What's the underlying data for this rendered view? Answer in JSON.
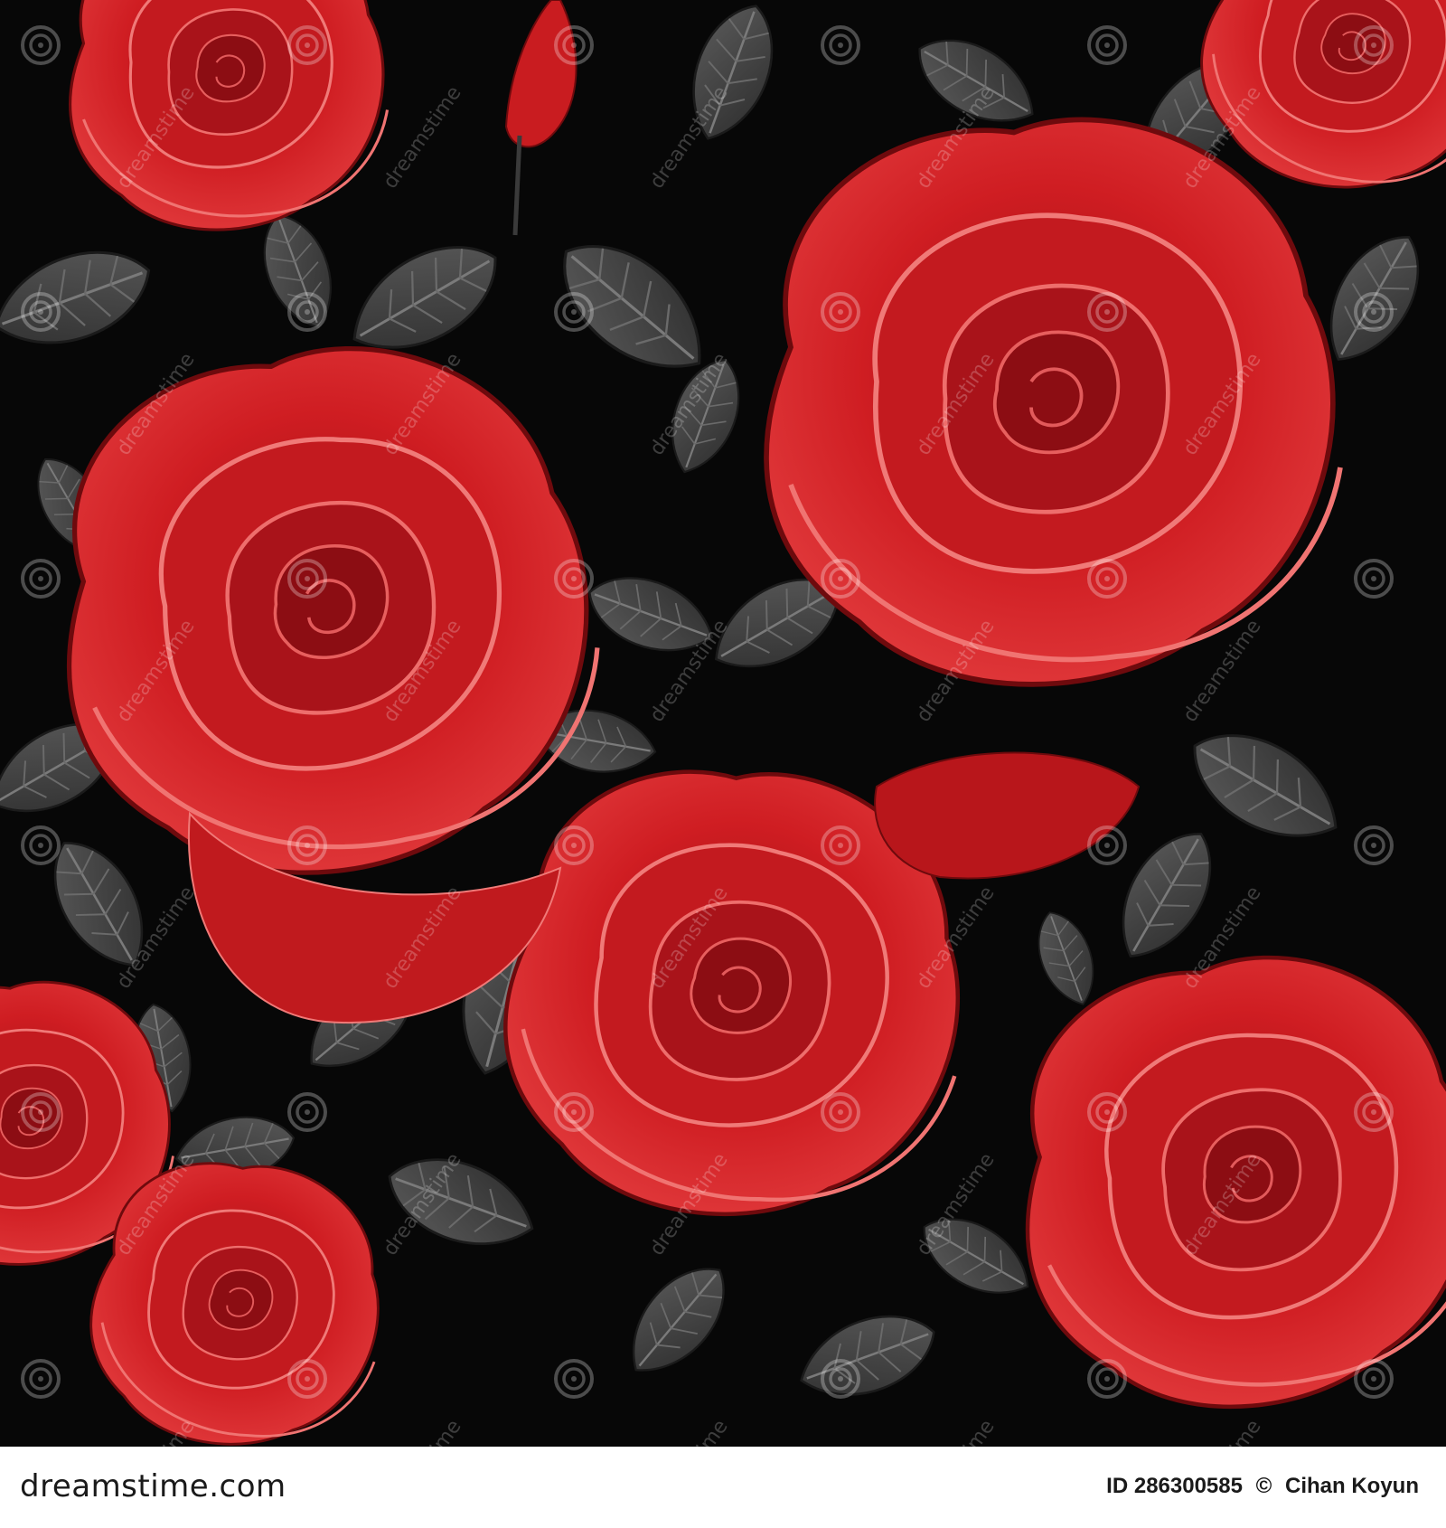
{
  "watermark": {
    "text": "dreamstime",
    "icon": "spiral-logo-icon"
  },
  "footer": {
    "site": "dreamstime.com",
    "id_label": "ID 286300585",
    "copyright": "©",
    "author": "Cihan Koyun"
  },
  "colors": {
    "background": "#070707",
    "rose_red": "#c41a1e",
    "rose_highlight": "#ef6d6f",
    "leaf_gray": "#4a4a4a"
  }
}
